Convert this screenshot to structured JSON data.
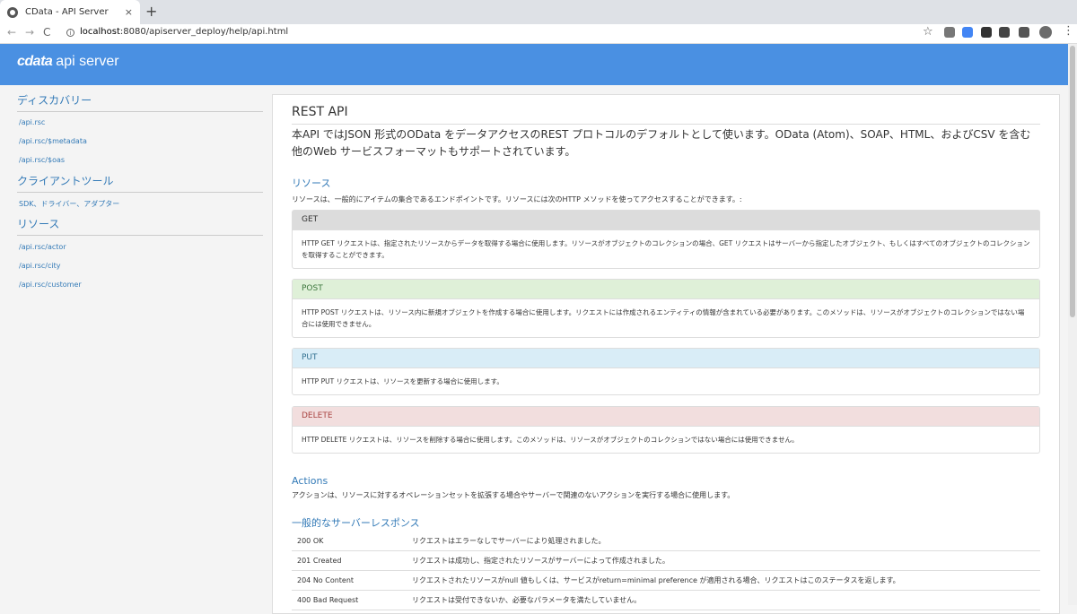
{
  "browser": {
    "tab_title": "CData - API Server",
    "tab_close": "×",
    "new_tab": "+",
    "url_host": "localhost",
    "url_rest": ":8080/apiserver_deploy/help/api.html",
    "back": "←",
    "forward": "→",
    "reload": "C",
    "star": "☆",
    "menu": "⋮",
    "extension_colors": [
      "#777777",
      "#4285f4",
      "#333333",
      "#444444",
      "#555555"
    ]
  },
  "header": {
    "logo_brand": "cdata",
    "logo_product": "api server",
    "background": "#4a90e2"
  },
  "sidebar": {
    "discovery_heading": "ディスカバリー",
    "discovery_links": [
      "/api.rsc",
      "/api.rsc/$metadata",
      "/api.rsc/$oas"
    ],
    "client_heading": "クライアントツール",
    "client_links": [
      "SDK、ドライバー、アダプター"
    ],
    "resources_heading": "リソース",
    "resource_links": [
      "/api.rsc/actor",
      "/api.rsc/city",
      "/api.rsc/customer"
    ]
  },
  "main": {
    "title": "REST API",
    "intro": "本API ではJSON 形式のOData をデータアクセスのREST プロトコルのデフォルトとして使います。OData (Atom)、SOAP、HTML、およびCSV を含む他のWeb サービスフォーマットもサポートされています。",
    "resources_heading": "リソース",
    "resources_desc": "リソースは、一般的にアイテムの集合であるエンドポイントです。リソースには次のHTTP メソッドを使ってアクセスすることができます。:",
    "methods": [
      {
        "name": "GET",
        "desc": "HTTP GET リクエストは、指定されたリソースからデータを取得する場合に使用します。リソースがオブジェクトのコレクションの場合、GET リクエストはサーバーから指定したオブジェクト、もしくはすべてのオブジェクトのコレクションを取得することができます。"
      },
      {
        "name": "POST",
        "desc": "HTTP POST リクエストは、リソース内に新規オブジェクトを作成する場合に使用します。リクエストには作成されるエンティティの情報が含まれている必要があります。このメソッドは、リソースがオブジェクトのコレクションではない場合には使用できません。"
      },
      {
        "name": "PUT",
        "desc": "HTTP PUT リクエストは、リソースを更新する場合に使用します。"
      },
      {
        "name": "DELETE",
        "desc": "HTTP DELETE リクエストは、リソースを削除する場合に使用します。このメソッドは、リソースがオブジェクトのコレクションではない場合には使用できません。"
      }
    ],
    "actions_heading": "Actions",
    "actions_desc": "アクションは、リソースに対するオペレーションセットを拡張する場合やサーバーで関連のないアクションを実行する場合に使用します。",
    "responses_heading": "一般的なサーバーレスポンス",
    "responses": [
      {
        "code": "200 OK",
        "desc": "リクエストはエラーなしでサーバーにより処理されました。"
      },
      {
        "code": "201 Created",
        "desc": "リクエストは成功し、指定されたリソースがサーバーによって作成されました。"
      },
      {
        "code": "204 No Content",
        "desc": "リクエストされたリソースがnull 値もしくは、サービスがreturn=minimal preference が適用される場合、リクエストはこのステータスを返します。"
      },
      {
        "code": "400 Bad Request",
        "desc": "リクエストは受付できないか、必要なパラメータを満たしていません。"
      }
    ]
  }
}
